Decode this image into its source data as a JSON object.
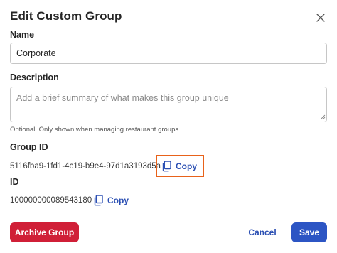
{
  "dialog": {
    "title": "Edit Custom Group"
  },
  "name_field": {
    "label": "Name",
    "value": "Corporate"
  },
  "description_field": {
    "label": "Description",
    "placeholder": "Add a brief summary of what makes this group unique",
    "value": "",
    "helper": "Optional. Only shown when managing restaurant groups."
  },
  "group_id": {
    "label": "Group ID",
    "value": "5116fba9-1fd1-4c19-b9e4-97d1a3193d5a",
    "copy_label": "Copy"
  },
  "id": {
    "label": "ID",
    "value": "100000000089543180",
    "copy_label": "Copy"
  },
  "footer": {
    "archive_label": "Archive Group",
    "cancel_label": "Cancel",
    "save_label": "Save"
  },
  "icons": {
    "close": "close-icon",
    "copy": "copy-icon",
    "resize": "resize-grip-icon"
  },
  "colors": {
    "primary": "#2c55c4",
    "link": "#2b4fb3",
    "danger": "#d01f37",
    "highlight": "#e8621a"
  }
}
